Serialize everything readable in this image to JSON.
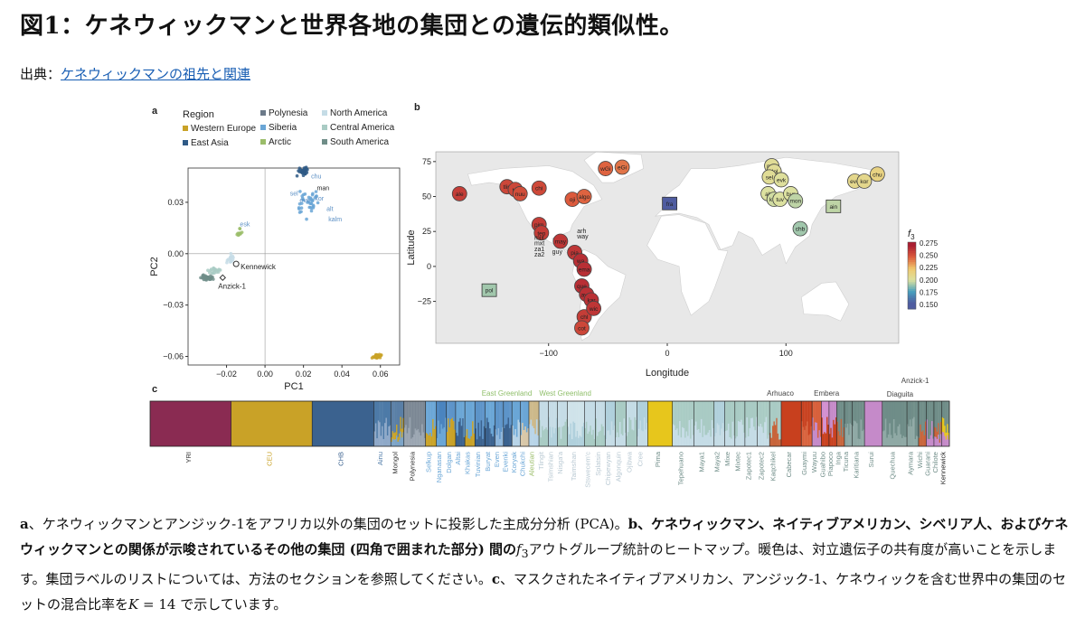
{
  "page": {
    "title": "図1：ケネウィックマンと世界各地の集団との遺伝的類似性。",
    "source_prefix": "出典：",
    "source_link": "ケネウィックマンの祖先と関連"
  },
  "caption": {
    "a_label": "a",
    "a_text": "、ケネウィックマンとアンジック-1をアフリカ以外の集団のセットに投影した主成分分析 (PCA)。",
    "b_label": "b",
    "b_bold": "、ケネウィックマン、ネイティブアメリカン、シベリア人、およびケネウィックマンとの関係が示唆されているその他の集団 (四角で囲まれた部分) 間の",
    "b_f": "f",
    "b_sub": "3",
    "b_text": "アウトグループ統計のヒートマップ。暖色は、対立遺伝子の共有度が高いことを示します。集団ラベルのリストについては、方法のセクションを参照してください。",
    "c_label": "c",
    "c_text": "、マスクされたネイティブアメリカン、アンジック-1、ケネウィックを含む世界中の集団のセットの混合比率を",
    "c_k": "K",
    "c_eq": " = 14 で示しています。"
  },
  "chart_data": [
    {
      "panel": "a",
      "type": "scatter",
      "title": "",
      "xlabel": "PC1",
      "ylabel": "PC2",
      "xlim": [
        -0.04,
        0.07
      ],
      "ylim": [
        -0.065,
        0.05
      ],
      "xticks": [
        -0.02,
        0.0,
        0.02,
        0.04,
        0.06
      ],
      "xtick_labels": [
        "−0.02",
        "0.00",
        "0.02",
        "0.04",
        "0.06"
      ],
      "yticks": [
        0.03,
        0.0,
        -0.03,
        -0.06
      ],
      "ytick_labels": [
        "0.03",
        "0.00",
        "−0.03",
        "−0.06"
      ],
      "legend_title": "Region",
      "legend": [
        {
          "name": "Western Europe",
          "color": "#c9a227"
        },
        {
          "name": "East Asia",
          "color": "#2f5a86"
        },
        {
          "name": "Polynesia",
          "color": "#6c7a89"
        },
        {
          "name": "Siberia",
          "color": "#6aa6d6"
        },
        {
          "name": "Arctic",
          "color": "#9bbd6a"
        },
        {
          "name": "North America",
          "color": "#c5dce6"
        },
        {
          "name": "Central America",
          "color": "#a9cbc4"
        },
        {
          "name": "South America",
          "color": "#6f8d88"
        }
      ],
      "clusters": [
        {
          "region": "Western Europe",
          "x": 0.058,
          "y": -0.06,
          "spread": [
            0.003,
            0.002
          ],
          "n": 30
        },
        {
          "region": "East Asia",
          "x": 0.02,
          "y": 0.048,
          "spread": [
            0.004,
            0.003
          ],
          "n": 28
        },
        {
          "region": "Siberia",
          "x": 0.022,
          "y": 0.03,
          "spread": [
            0.008,
            0.012
          ],
          "n": 40
        },
        {
          "region": "Arctic",
          "x": -0.013,
          "y": 0.012,
          "spread": [
            0.002,
            0.004
          ],
          "n": 10
        },
        {
          "region": "North America",
          "x": -0.018,
          "y": -0.003,
          "spread": [
            0.003,
            0.004
          ],
          "n": 14
        },
        {
          "region": "Central America",
          "x": -0.026,
          "y": -0.01,
          "spread": [
            0.005,
            0.003
          ],
          "n": 20
        },
        {
          "region": "South America",
          "x": -0.03,
          "y": -0.014,
          "spread": [
            0.004,
            0.002
          ],
          "n": 30
        }
      ],
      "points_labeled": [
        {
          "label": "Kennewick",
          "x": -0.015,
          "y": -0.006
        },
        {
          "label": "Anzick-1",
          "x": -0.022,
          "y": -0.014
        }
      ],
      "cluster_labels": [
        "chu",
        "man",
        "alt",
        "kalm",
        "sel",
        "eve",
        "kor",
        "esk"
      ]
    },
    {
      "panel": "b",
      "type": "heatmap",
      "title": "",
      "xlabel": "Longitude",
      "ylabel": "Latitude",
      "xlim": [
        -195,
        195
      ],
      "ylim": [
        -55,
        82
      ],
      "xticks": [
        -100,
        0,
        100
      ],
      "xtick_labels": [
        "−100",
        "0",
        "100"
      ],
      "yticks": [
        75,
        50,
        25,
        0,
        -25
      ],
      "ytick_labels": [
        "75",
        "50",
        "25",
        "0",
        "−25"
      ],
      "colorbar_label": "f3",
      "colorbar_ticks": [
        "0.275",
        "0.250",
        "0.225",
        "0.200",
        "0.175",
        "0.150"
      ],
      "colorbar_range": [
        0.14,
        0.28
      ],
      "populations": [
        {
          "label": "ale",
          "lon": -175,
          "lat": 52,
          "f3": 0.262,
          "box": false
        },
        {
          "label": "tlin",
          "lon": -135,
          "lat": 57,
          "f3": 0.258,
          "box": false
        },
        {
          "label": "tsi",
          "lon": -128,
          "lat": 55,
          "f3": 0.258,
          "box": false
        },
        {
          "label": "nuu",
          "lon": -124,
          "lat": 52,
          "f3": 0.255,
          "box": false
        },
        {
          "label": "chi",
          "lon": -108,
          "lat": 56,
          "f3": 0.257,
          "box": false
        },
        {
          "label": "oji",
          "lon": -80,
          "lat": 48,
          "f3": 0.25,
          "box": false
        },
        {
          "label": "algo",
          "lon": -70,
          "lat": 50,
          "f3": 0.248,
          "box": false
        },
        {
          "label": "wGi",
          "lon": -52,
          "lat": 70,
          "f3": 0.248,
          "box": false
        },
        {
          "label": "eGi",
          "lon": -38,
          "lat": 71,
          "f3": 0.244,
          "box": false
        },
        {
          "label": "pim",
          "lon": -108,
          "lat": 30,
          "f3": 0.262,
          "box": false
        },
        {
          "label": "tep",
          "lon": -106,
          "lat": 24,
          "f3": 0.262,
          "box": false
        },
        {
          "label": "may",
          "lon": -90,
          "lat": 18,
          "f3": 0.265,
          "box": false
        },
        {
          "label": "pia",
          "lon": -78,
          "lat": 10,
          "f3": 0.265,
          "box": false
        },
        {
          "label": "wa",
          "lon": -73,
          "lat": 4,
          "f3": 0.268,
          "box": false
        },
        {
          "label": "ema",
          "lon": -70,
          "lat": -2,
          "f3": 0.268,
          "box": false
        },
        {
          "label": "que",
          "lon": -72,
          "lat": -14,
          "f3": 0.268,
          "box": false
        },
        {
          "label": "aym",
          "lon": -68,
          "lat": -20,
          "f3": 0.267,
          "box": false
        },
        {
          "label": "kar",
          "lon": -64,
          "lat": -24,
          "f3": 0.267,
          "box": false
        },
        {
          "label": "chl",
          "lon": -70,
          "lat": -36,
          "f3": 0.262,
          "box": false
        },
        {
          "label": "wic",
          "lon": -62,
          "lat": -30,
          "f3": 0.265,
          "box": false
        },
        {
          "label": "cot",
          "lon": -72,
          "lat": -44,
          "f3": 0.258,
          "box": false
        },
        {
          "label": "fra",
          "lon": 2,
          "lat": 45,
          "f3": 0.15,
          "box": true
        },
        {
          "label": "pol",
          "lon": -150,
          "lat": -17,
          "f3": 0.19,
          "box": true
        },
        {
          "label": "ain",
          "lon": 140,
          "lat": 43,
          "f3": 0.195,
          "box": true
        },
        {
          "label": "nga",
          "lon": 88,
          "lat": 72,
          "f3": 0.205,
          "box": false
        },
        {
          "label": "dol",
          "lon": 90,
          "lat": 68,
          "f3": 0.205,
          "box": false
        },
        {
          "label": "sel",
          "lon": 86,
          "lat": 64,
          "f3": 0.205,
          "box": false
        },
        {
          "label": "evk",
          "lon": 96,
          "lat": 62,
          "f3": 0.202,
          "box": false
        },
        {
          "label": "alt",
          "lon": 85,
          "lat": 52,
          "f3": 0.2,
          "box": false
        },
        {
          "label": "kha",
          "lon": 90,
          "lat": 48,
          "f3": 0.198,
          "box": false
        },
        {
          "label": "tuv",
          "lon": 95,
          "lat": 48,
          "f3": 0.2,
          "box": false
        },
        {
          "label": "bur",
          "lon": 104,
          "lat": 52,
          "f3": 0.2,
          "box": false
        },
        {
          "label": "mon",
          "lon": 108,
          "lat": 47,
          "f3": 0.195,
          "box": false
        },
        {
          "label": "chb",
          "lon": 112,
          "lat": 27,
          "f3": 0.19,
          "box": false
        },
        {
          "label": "eve",
          "lon": 158,
          "lat": 61,
          "f3": 0.21,
          "box": false
        },
        {
          "label": "kor",
          "lon": 166,
          "lat": 61,
          "f3": 0.21,
          "box": false
        },
        {
          "label": "chu",
          "lon": 177,
          "lat": 66,
          "f3": 0.215,
          "box": false
        }
      ],
      "text_labels": [
        "arh",
        "way",
        "mix",
        "mxt",
        "za1",
        "za2",
        "guy"
      ]
    },
    {
      "panel": "c",
      "type": "bar",
      "title": "",
      "description_k": 14,
      "top_labels": [
        "East Greenland",
        "West Greenland",
        "Arhuaco",
        "Embera",
        "Anzick-1",
        "Diaguita"
      ],
      "populations": [
        {
          "name": "YRI",
          "width": 10.5,
          "colors": [
            "#8a2b52"
          ],
          "label_color": "#333333"
        },
        {
          "name": "CEU",
          "width": 10.5,
          "colors": [
            "#c9a227"
          ],
          "label_color": "#c9a227"
        },
        {
          "name": "CHB",
          "width": 8.0,
          "colors": [
            "#3b628f"
          ],
          "label_color": "#3b628f"
        },
        {
          "name": "Ainu",
          "width": 2.2,
          "colors": [
            "#4d7aa7",
            "#8fa9c9"
          ],
          "label_color": "#4d7aa7"
        },
        {
          "name": "Mongol",
          "width": 1.7,
          "colors": [
            "#5a7fa6",
            "#c9a227",
            "#7da4c7"
          ],
          "label_color": "#333333"
        },
        {
          "name": "Polynesia",
          "width": 2.8,
          "colors": [
            "#7b8794",
            "#9aa5b1"
          ],
          "label_color": "#333333"
        },
        {
          "name": "Selkup",
          "width": 1.4,
          "colors": [
            "#6aa6d6",
            "#c9a227"
          ],
          "label_color": "#6aa6d6"
        },
        {
          "name": "Nganasan",
          "width": 1.3,
          "colors": [
            "#4b84bf",
            "#6aa6d6"
          ],
          "label_color": "#6aa6d6"
        },
        {
          "name": "Dolgan",
          "width": 1.2,
          "colors": [
            "#5d94c9",
            "#c9a227"
          ],
          "label_color": "#6aa6d6"
        },
        {
          "name": "Altai",
          "width": 1.2,
          "colors": [
            "#6aa6d6",
            "#3b628f"
          ],
          "label_color": "#6aa6d6"
        },
        {
          "name": "Khakas",
          "width": 1.3,
          "colors": [
            "#6aa6d6",
            "#c9a227"
          ],
          "label_color": "#6aa6d6"
        },
        {
          "name": "Tuvinian",
          "width": 1.3,
          "colors": [
            "#5d94c9",
            "#3b628f"
          ],
          "label_color": "#6aa6d6"
        },
        {
          "name": "Buryat",
          "width": 1.3,
          "colors": [
            "#6aa6d6",
            "#3b628f"
          ],
          "label_color": "#6aa6d6"
        },
        {
          "name": "Even",
          "width": 1.1,
          "colors": [
            "#5d94c9",
            "#8fb7dc"
          ],
          "label_color": "#6aa6d6"
        },
        {
          "name": "Evenki",
          "width": 1.1,
          "colors": [
            "#5d94c9",
            "#3b628f"
          ],
          "label_color": "#6aa6d6"
        },
        {
          "name": "Koryak",
          "width": 1.1,
          "colors": [
            "#6aa6d6",
            "#b8d4e8"
          ],
          "label_color": "#6aa6d6"
        },
        {
          "name": "Chukchi",
          "width": 1.1,
          "colors": [
            "#6aa6d6",
            "#d8c7a8"
          ],
          "label_color": "#6aa6d6"
        },
        {
          "name": "Aleutian",
          "width": 1.3,
          "colors": [
            "#cdb98a",
            "#b8d4e8"
          ],
          "label_color": "#9bbd6a"
        },
        {
          "name": "Tlingit",
          "width": 1.2,
          "colors": [
            "#c5dce6",
            "#a9cbc4"
          ],
          "label_color": "#b9c9d3"
        },
        {
          "name": "Tsimshian",
          "width": 1.2,
          "colors": [
            "#c5dce6",
            "#b0d0dc"
          ],
          "label_color": "#b9c9d3"
        },
        {
          "name": "Nisga'a",
          "width": 1.3,
          "colors": [
            "#c5dce6",
            "#a9cbc4"
          ],
          "label_color": "#b9c9d3"
        },
        {
          "name": "Taimshan",
          "width": 2.2,
          "colors": [
            "#cfe3ea",
            "#b0d0dc"
          ],
          "label_color": "#b9c9d3"
        },
        {
          "name": "Stswecem'c",
          "width": 1.4,
          "colors": [
            "#c5dce6",
            "#a9cbc4"
          ],
          "label_color": "#b9c9d3"
        },
        {
          "name": "Splatsin",
          "width": 1.3,
          "colors": [
            "#c5dce6",
            "#a9cbc4"
          ],
          "label_color": "#b9c9d3"
        },
        {
          "name": "Chipewyan",
          "width": 1.3,
          "colors": [
            "#b0d0dc",
            "#c5dce6"
          ],
          "label_color": "#b9c9d3"
        },
        {
          "name": "Algonquin",
          "width": 1.4,
          "colors": [
            "#a9cbc4",
            "#c5dce6"
          ],
          "label_color": "#b9c9d3"
        },
        {
          "name": "Ojibwa",
          "width": 1.4,
          "colors": [
            "#c5dce6",
            "#a9cbc4"
          ],
          "label_color": "#b9c9d3"
        },
        {
          "name": "Cree",
          "width": 1.4,
          "colors": [
            "#b0d0dc",
            "#c5dce6"
          ],
          "label_color": "#b9c9d3"
        },
        {
          "name": "Pima",
          "width": 3.2,
          "colors": [
            "#e7c61c"
          ],
          "label_color": "#6f8d88"
        },
        {
          "name": "Tepehuano",
          "width": 2.8,
          "colors": [
            "#a9cbc4",
            "#c5dce6"
          ],
          "label_color": "#6f8d88"
        },
        {
          "name": "Maya1",
          "width": 2.6,
          "colors": [
            "#a9cbc4",
            "#c5dce6"
          ],
          "label_color": "#6f8d88"
        },
        {
          "name": "Maya2",
          "width": 1.4,
          "colors": [
            "#b0d0dc",
            "#c5dce6"
          ],
          "label_color": "#6f8d88"
        },
        {
          "name": "Mixe",
          "width": 1.3,
          "colors": [
            "#a9cbc4",
            "#c5dce6"
          ],
          "label_color": "#6f8d88"
        },
        {
          "name": "Mixtec",
          "width": 1.3,
          "colors": [
            "#a9cbc4",
            "#c5dce6"
          ],
          "label_color": "#6f8d88"
        },
        {
          "name": "Zapotec1",
          "width": 1.6,
          "colors": [
            "#a9cbc4",
            "#c5dce6"
          ],
          "label_color": "#6f8d88"
        },
        {
          "name": "Zapotec2",
          "width": 1.6,
          "colors": [
            "#a9cbc4",
            "#c5dce6"
          ],
          "label_color": "#6f8d88"
        },
        {
          "name": "Kaqchikel",
          "width": 1.5,
          "colors": [
            "#a9cbc4",
            "#c8643a"
          ],
          "label_color": "#6f8d88"
        },
        {
          "name": "Cabecar",
          "width": 2.6,
          "colors": [
            "#c8401e"
          ],
          "label_color": "#6f8d88"
        },
        {
          "name": "Guaymi",
          "width": 1.4,
          "colors": [
            "#c8401e",
            "#d8613c"
          ],
          "label_color": "#6f8d88"
        },
        {
          "name": "Wayuu",
          "width": 1.2,
          "colors": [
            "#d8613c",
            "#c58ac9"
          ],
          "label_color": "#6f8d88"
        },
        {
          "name": "Guahibo",
          "width": 1.0,
          "colors": [
            "#d28fd0",
            "#c8401e"
          ],
          "label_color": "#6f8d88"
        },
        {
          "name": "Piapoco",
          "width": 1.0,
          "colors": [
            "#c58ac9",
            "#c8401e"
          ],
          "label_color": "#6f8d88"
        },
        {
          "name": "Inga",
          "width": 1.0,
          "colors": [
            "#6f8d88",
            "#c8643a"
          ],
          "label_color": "#6f8d88"
        },
        {
          "name": "Ticuna",
          "width": 1.0,
          "colors": [
            "#6f8d88",
            "#8fa9a5"
          ],
          "label_color": "#6f8d88"
        },
        {
          "name": "Karitiana",
          "width": 1.6,
          "colors": [
            "#6f8d88",
            "#8fa9a5"
          ],
          "label_color": "#6f8d88"
        },
        {
          "name": "Surui",
          "width": 2.3,
          "colors": [
            "#c58ac9"
          ],
          "label_color": "#6f8d88"
        },
        {
          "name": "Quechua",
          "width": 3.2,
          "colors": [
            "#6f8d88",
            "#8fa9a5"
          ],
          "label_color": "#6f8d88"
        },
        {
          "name": "Aymara",
          "width": 1.5,
          "colors": [
            "#6f8d88",
            "#8fa9a5"
          ],
          "label_color": "#6f8d88"
        },
        {
          "name": "Wichi",
          "width": 1.0,
          "colors": [
            "#6f8d88",
            "#c8643a"
          ],
          "label_color": "#6f8d88"
        },
        {
          "name": "Guarani",
          "width": 1.0,
          "colors": [
            "#6f8d88",
            "#c58ac9"
          ],
          "label_color": "#6f8d88"
        },
        {
          "name": "Chilote",
          "width": 1.0,
          "colors": [
            "#6f8d88",
            "#c8643a",
            "#c58ac9"
          ],
          "label_color": "#6f8d88"
        },
        {
          "name": "Kennewick",
          "width": 1.0,
          "colors": [
            "#6f8d88",
            "#e7c61c",
            "#c58ac9"
          ],
          "label_color": "#222222"
        }
      ]
    }
  ]
}
